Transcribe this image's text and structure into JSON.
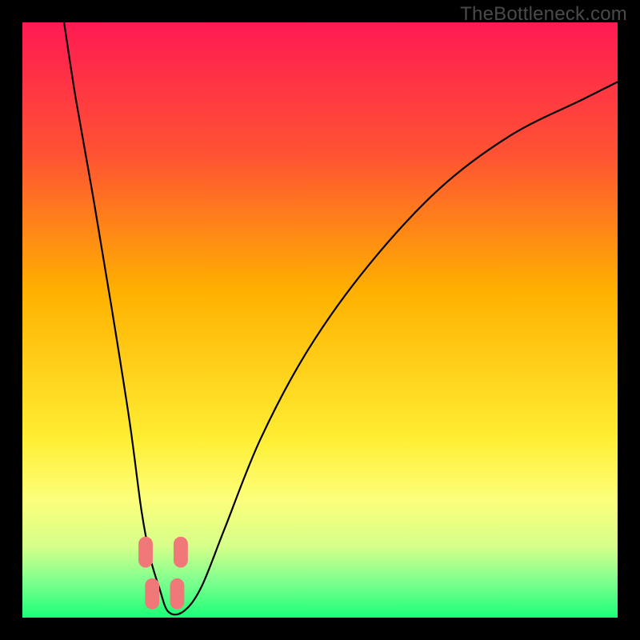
{
  "watermark": "TheBottleneck.com",
  "chart_data": {
    "type": "line",
    "title": "",
    "xlabel": "",
    "ylabel": "",
    "xlim": [
      0,
      100
    ],
    "ylim": [
      0,
      100
    ],
    "grid": false,
    "legend": false,
    "background_gradient": {
      "stops": [
        {
          "offset": 0.0,
          "color": "#ff1a53"
        },
        {
          "offset": 0.22,
          "color": "#ff5233"
        },
        {
          "offset": 0.45,
          "color": "#ffb000"
        },
        {
          "offset": 0.7,
          "color": "#ffee33"
        },
        {
          "offset": 0.8,
          "color": "#fdff7a"
        },
        {
          "offset": 0.88,
          "color": "#d6ff8a"
        },
        {
          "offset": 0.94,
          "color": "#7dff8e"
        },
        {
          "offset": 1.0,
          "color": "#1bff77"
        }
      ]
    },
    "series": [
      {
        "name": "curve",
        "x": [
          7,
          9,
          12,
          15,
          18,
          20,
          21.5,
          23,
          24.5,
          27,
          30,
          34,
          40,
          48,
          58,
          70,
          82,
          94,
          100
        ],
        "y": [
          100,
          87,
          70,
          52,
          33,
          18,
          10,
          5,
          1,
          1,
          5,
          15,
          30,
          45,
          59,
          72,
          81,
          87,
          90
        ]
      }
    ],
    "markers": [
      {
        "x": 20.7,
        "y": 11
      },
      {
        "x": 26.6,
        "y": 11
      },
      {
        "x": 21.8,
        "y": 4
      },
      {
        "x": 26.0,
        "y": 4
      }
    ],
    "marker_style": {
      "shape": "rounded-rect",
      "color": "#f07878",
      "w": 2.4,
      "h": 5.2,
      "rx": 1.2
    }
  }
}
